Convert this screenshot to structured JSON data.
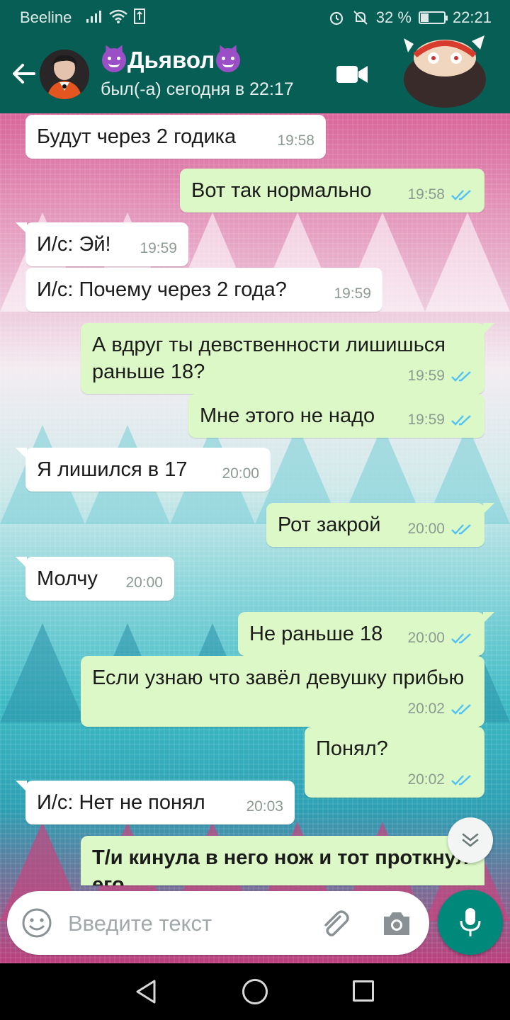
{
  "status_bar": {
    "carrier": "Beeline",
    "battery": "32 %",
    "battery_level": 0.32,
    "time": "22:21"
  },
  "header": {
    "name": "Дьявол",
    "status": "был(-а) сегодня в 22:17"
  },
  "messages": [
    {
      "text": "Будут через 2 годика",
      "time": "19:58",
      "direction": "in"
    },
    {
      "text": "Вот так нормально",
      "time": "19:58",
      "direction": "out",
      "read": true
    },
    {
      "text": "И/с: Эй!",
      "time": "19:59",
      "direction": "in"
    },
    {
      "text": "И/с: Почему через 2 года?",
      "time": "19:59",
      "direction": "in"
    },
    {
      "text": "А вдруг ты девственности лишишься раньше 18?",
      "time": "19:59",
      "direction": "out",
      "read": true
    },
    {
      "text": "Мне этого не надо",
      "time": "19:59",
      "direction": "out",
      "read": true
    },
    {
      "text": "Я лишился в 17",
      "time": "20:00",
      "direction": "in"
    },
    {
      "text": "Рот закрой",
      "time": "20:00",
      "direction": "out",
      "read": true
    },
    {
      "text": "Молчу",
      "time": "20:00",
      "direction": "in"
    },
    {
      "text": "Не раньше 18",
      "time": "20:00",
      "direction": "out",
      "read": true
    },
    {
      "text": "Если узнаю что завёл девушку прибью",
      "time": "20:02",
      "direction": "out",
      "read": true
    },
    {
      "text": "Понял?",
      "time": "20:02",
      "direction": "out",
      "read": true
    },
    {
      "text": "И/с: Нет не понял",
      "time": "20:03",
      "direction": "in"
    },
    {
      "text": "Т/и кинула в него нож и тот проткнул его",
      "direction": "out",
      "bold": true
    }
  ],
  "composer": {
    "placeholder": "Введите текст"
  },
  "colors": {
    "header": "#075e54",
    "outgoing_bubble": "#dcf8c6",
    "incoming_bubble": "#ffffff",
    "read_ticks": "#4fc3f7",
    "mic_button": "#00897b"
  }
}
